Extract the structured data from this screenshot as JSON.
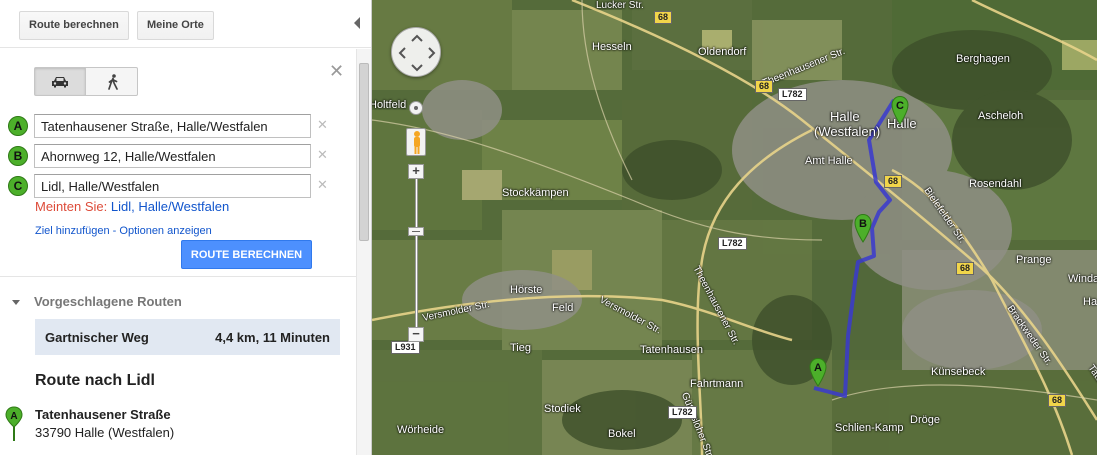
{
  "toolbar": {
    "route_button": "Route berechnen",
    "places_button": "Meine Orte"
  },
  "modes": {
    "car_icon": "car-icon",
    "walk_icon": "walking-icon",
    "selected": "car"
  },
  "waypoints": [
    {
      "letter": "A",
      "value": "Tatenhausener Straße, Halle/Westfalen"
    },
    {
      "letter": "B",
      "value": "Ahornweg 12, Halle/Westfalen"
    },
    {
      "letter": "C",
      "value": "Lidl, Halle/Westfalen"
    }
  ],
  "suggestion": {
    "prefix": "Meinten Sie:",
    "part1": "Lidl",
    "separator": ",",
    "part2": "Halle/Westfalen"
  },
  "links": {
    "add_destination": "Ziel hinzufügen",
    "separator": "-",
    "options": "Optionen anzeigen"
  },
  "calculate_button": "ROUTE BERECHNEN",
  "suggested_routes": {
    "header": "Vorgeschlagene Routen",
    "items": [
      {
        "name": "Gartnischer Weg",
        "summary": "4,4 km, 11 Minuten"
      }
    ]
  },
  "directions": {
    "title": "Route nach Lidl",
    "start_letter": "A",
    "start_name": "Tatenhausener Straße",
    "start_address": "33790 Halle (Westfalen)"
  },
  "map": {
    "places": {
      "hesseln": "Hesseln",
      "oldendorf": "Oldendorf",
      "berghagen": "Berghagen",
      "holtfeld": "Holtfeld",
      "halle": "Halle",
      "halle2": "(Westfalen)",
      "halle_c": "Halle",
      "ascheloh": "Ascheloh",
      "amt_halle": "Amt Halle",
      "stockkaempen": "Stockkämpen",
      "rosendahl": "Rosendahl",
      "hoerste": "Hörste",
      "feld": "Feld",
      "prange": "Prange",
      "winda": "Winda",
      "tieg": "Tieg",
      "tatenhausen": "Tatenhausen",
      "fahrtmann": "Fahrtmann",
      "kuensebeck": "Künsebeck",
      "stodiek": "Stodiek",
      "woerheide": "Wörheide",
      "bokel": "Bokel",
      "schlien_kamp": "Schlien-Kamp",
      "droege": "Dröge",
      "ha": "Ha"
    },
    "streets": {
      "versmolder1": "Versmolder Str.",
      "versmolder2": "Versmolder Str.",
      "theenhausener1": "Theenhausener Str.",
      "theenhausener2": "Theenhausener Str.",
      "bielefelder": "Bielefelder Str.",
      "brackweder": "Brackweder Str.",
      "tatenhausener": "Tatenhausener Str.",
      "guetersloher": "Gütersloher Str.",
      "lucker": "Lucker Str."
    },
    "road_signs": {
      "r68a": "68",
      "r68b": "68",
      "r68c": "68",
      "r68d": "68",
      "r68e": "68",
      "l782a": "L782",
      "l782b": "L782",
      "l782c": "L782",
      "l931": "L931"
    },
    "markers": {
      "a": "A",
      "b": "B",
      "c": "C"
    },
    "colors": {
      "route": "#3a3acf",
      "marker": "#4caf2a"
    }
  }
}
